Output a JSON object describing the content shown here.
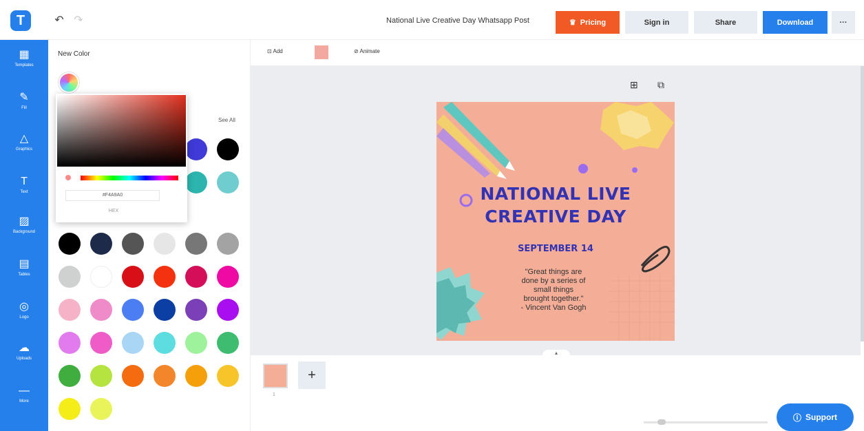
{
  "app": {
    "logo_letter": "T",
    "doc_title": "National Live Creative Day Whatsapp Post"
  },
  "toolbar": {
    "undo_icon": "↶",
    "redo_icon": "↷",
    "pricing_label": "Pricing",
    "signin_label": "Sign in",
    "share_label": "Share",
    "download_label": "Download",
    "more_label": "···"
  },
  "nav": {
    "items": [
      {
        "icon": "▦",
        "label": "Templates"
      },
      {
        "icon": "✎",
        "label": "Fill"
      },
      {
        "icon": "△",
        "label": "Graphics"
      },
      {
        "icon": "T",
        "label": "Text"
      },
      {
        "icon": "▨",
        "label": "Background"
      },
      {
        "icon": "▤",
        "label": "Tables"
      },
      {
        "icon": "◎",
        "label": "Logo"
      },
      {
        "icon": "☁",
        "label": "Uploads"
      },
      {
        "icon": "—",
        "label": "More"
      }
    ]
  },
  "panel": {
    "title": "New Color",
    "see_all": "See All",
    "picker_hex": "#F4A9A0",
    "picker_hex_label": "HEX",
    "colors": [
      "#3f3ad8",
      "#000000",
      "#2bb5ae",
      "#6fcccf",
      "#000000",
      "#1e2a4a",
      "#555555",
      "#e6e6e6",
      "#777777",
      "#a3a3a3",
      "#cfd0d0",
      "#ffffff",
      "#d80f17",
      "#f43210",
      "#d50e5a",
      "#ee0aa3",
      "#f6b3c7",
      "#f08bc9",
      "#4a7ef2",
      "#0b3fa3",
      "#7b3fb8",
      "#a90ef0",
      "#e27cee",
      "#f05cc7",
      "#a9d6f5",
      "#5ddde0",
      "#9ef29c",
      "#3ebc70",
      "#3fae3f",
      "#b5e33f",
      "#f56c10",
      "#f3862b",
      "#f5a00a",
      "#f7c529",
      "#f5ed18",
      "#e9f45b"
    ]
  },
  "canvas": {
    "toolbar_add": "Add",
    "toolbar_animate": "Animate",
    "bg_color": "#f4ae98",
    "design": {
      "title_line1": "NATIONAL LIVE",
      "title_line2": "CREATIVE DAY",
      "date": "SEPTEMBER 14",
      "quote": "\"Great things are\ndone by a series of\nsmall things\nbrought together.\"\n- Vincent Van Gogh"
    }
  },
  "pages": {
    "add_label": "+",
    "page_number": "1"
  },
  "support": {
    "label": "Support"
  }
}
